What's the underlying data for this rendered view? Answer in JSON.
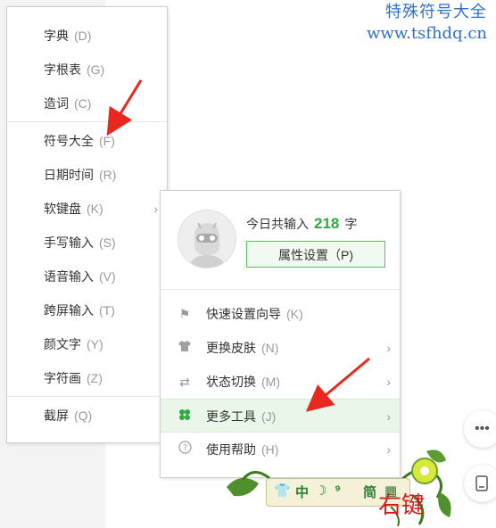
{
  "watermark": {
    "line1": "特殊符号大全",
    "line2": "www.tsfhdq.cn"
  },
  "menu1": {
    "items": [
      {
        "label": "字典",
        "key": "(D)"
      },
      {
        "label": "字根表",
        "key": "(G)"
      },
      {
        "label": "造词",
        "key": "(C)"
      },
      {
        "label": "符号大全",
        "key": "(F)"
      },
      {
        "label": "日期时间",
        "key": "(R)"
      },
      {
        "label": "软键盘",
        "key": "(K)",
        "arrow": "›"
      },
      {
        "label": "手写输入",
        "key": "(S)"
      },
      {
        "label": "语音输入",
        "key": "(V)"
      },
      {
        "label": "跨屏输入",
        "key": "(T)"
      },
      {
        "label": "颜文字",
        "key": "(Y)"
      },
      {
        "label": "字符画",
        "key": "(Z)"
      },
      {
        "label": "截屏",
        "key": "(Q)"
      }
    ]
  },
  "menu2": {
    "today_prefix": "今日共输入",
    "today_count": "218",
    "today_suffix": "字",
    "prop_button": "属性设置（P)",
    "items": [
      {
        "label": "快速设置向导",
        "key": "(K)",
        "icon": "flag-icon"
      },
      {
        "label": "更换皮肤",
        "key": "(N)",
        "icon": "tshirt-icon",
        "arrow": "›"
      },
      {
        "label": "状态切换",
        "key": "(M)",
        "icon": "switch-arrows-icon",
        "arrow": "›"
      },
      {
        "label": "更多工具",
        "key": "(J)",
        "icon": "clover-icon",
        "arrow": "›"
      },
      {
        "label": "使用帮助",
        "key": "(H)",
        "icon": "help-icon",
        "arrow": "›"
      }
    ]
  },
  "ime_toolbar": {
    "mode": "中",
    "simp": "简"
  },
  "caption": "右键",
  "colors": {
    "accent_green": "#2eaa3e",
    "annotation_red": "#d31b1b",
    "watermark_blue": "#2f6fc9"
  }
}
